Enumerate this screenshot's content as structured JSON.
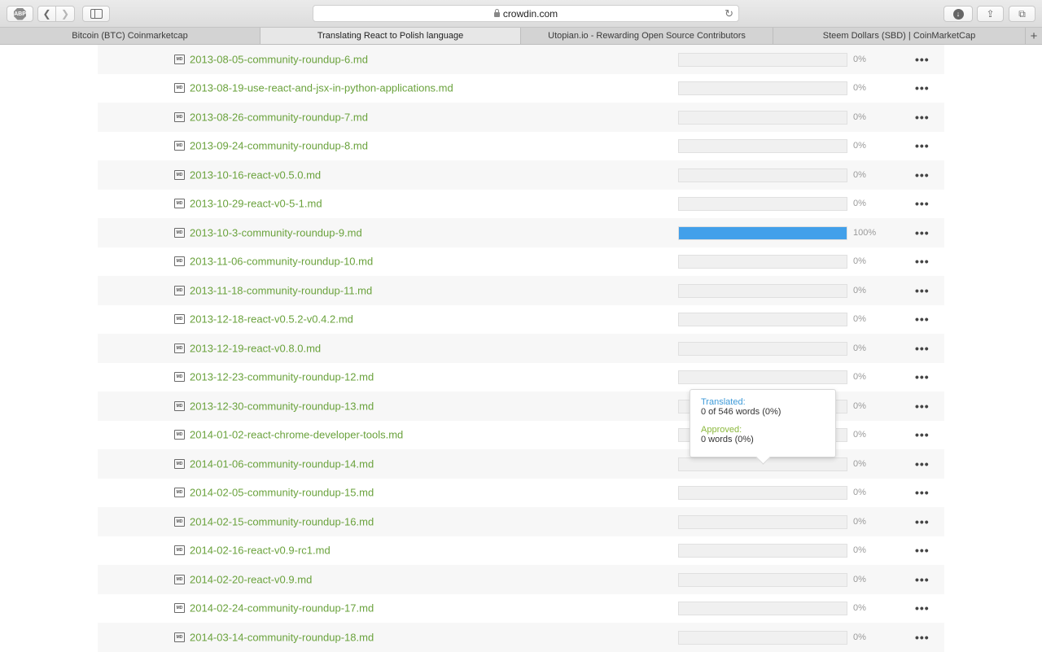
{
  "browser": {
    "url": "crowdin.com",
    "tabs": [
      {
        "label": "Bitcoin (BTC) Coinmarketcap",
        "active": false
      },
      {
        "label": "Translating React to Polish language",
        "active": true
      },
      {
        "label": "Utopian.io - Rewarding Open Source Contributors",
        "active": false
      },
      {
        "label": "Steem Dollars (SBD) | CoinMarketCap",
        "active": false
      }
    ],
    "abp_label": "ABP"
  },
  "file_icon_label": "MD",
  "more_label": "•••",
  "files": [
    {
      "name": "2013-08-05-community-roundup-6.md",
      "progress": 0,
      "pct": "0%"
    },
    {
      "name": "2013-08-19-use-react-and-jsx-in-python-applications.md",
      "progress": 0,
      "pct": "0%"
    },
    {
      "name": "2013-08-26-community-roundup-7.md",
      "progress": 0,
      "pct": "0%"
    },
    {
      "name": "2013-09-24-community-roundup-8.md",
      "progress": 0,
      "pct": "0%"
    },
    {
      "name": "2013-10-16-react-v0.5.0.md",
      "progress": 0,
      "pct": "0%"
    },
    {
      "name": "2013-10-29-react-v0-5-1.md",
      "progress": 0,
      "pct": "0%"
    },
    {
      "name": "2013-10-3-community-roundup-9.md",
      "progress": 100,
      "pct": "100%"
    },
    {
      "name": "2013-11-06-community-roundup-10.md",
      "progress": 0,
      "pct": "0%"
    },
    {
      "name": "2013-11-18-community-roundup-11.md",
      "progress": 0,
      "pct": "0%"
    },
    {
      "name": "2013-12-18-react-v0.5.2-v0.4.2.md",
      "progress": 0,
      "pct": "0%"
    },
    {
      "name": "2013-12-19-react-v0.8.0.md",
      "progress": 0,
      "pct": "0%"
    },
    {
      "name": "2013-12-23-community-roundup-12.md",
      "progress": 0,
      "pct": "0%"
    },
    {
      "name": "2013-12-30-community-roundup-13.md",
      "progress": 0,
      "pct": "0%"
    },
    {
      "name": "2014-01-02-react-chrome-developer-tools.md",
      "progress": 0,
      "pct": "0%"
    },
    {
      "name": "2014-01-06-community-roundup-14.md",
      "progress": 0,
      "pct": "0%"
    },
    {
      "name": "2014-02-05-community-roundup-15.md",
      "progress": 0,
      "pct": "0%"
    },
    {
      "name": "2014-02-15-community-roundup-16.md",
      "progress": 0,
      "pct": "0%"
    },
    {
      "name": "2014-02-16-react-v0.9-rc1.md",
      "progress": 0,
      "pct": "0%"
    },
    {
      "name": "2014-02-20-react-v0.9.md",
      "progress": 0,
      "pct": "0%"
    },
    {
      "name": "2014-02-24-community-roundup-17.md",
      "progress": 0,
      "pct": "0%"
    },
    {
      "name": "2014-03-14-community-roundup-18.md",
      "progress": 0,
      "pct": "0%"
    }
  ],
  "tooltip": {
    "translated_label": "Translated:",
    "translated_value": "0 of 546 words (0%)",
    "approved_label": "Approved:",
    "approved_value": "0 words (0%)"
  },
  "colors": {
    "link": "#6aa23c",
    "progress_fill": "#42a0ea",
    "translated_label": "#3d9ad8",
    "approved_label": "#8bb83c"
  }
}
